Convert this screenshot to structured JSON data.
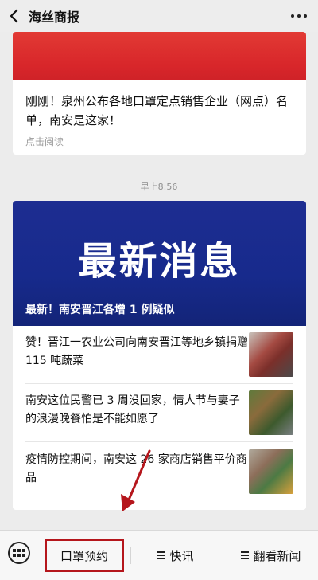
{
  "header": {
    "title": "海丝商报"
  },
  "card1": {
    "headline": "刚刚！泉州公布各地口罩定点销售企业（网点）名单，南安是这家！",
    "read_more": "点击阅读"
  },
  "timestamp": "早上8:56",
  "card2": {
    "hero_text": "最新消息",
    "hero_caption": "最新！南安晋江各增 1 例疑似",
    "items": [
      {
        "text": "赞！晋江一农业公司向南安晋江等地乡镇捐赠 115 吨蔬菜"
      },
      {
        "text": "南安这位民警已 3 周没回家，情人节与妻子的浪漫晚餐怕是不能如愿了"
      },
      {
        "text": "疫情防控期间，南安这 26 家商店销售平价商品"
      }
    ]
  },
  "bottom_menu": {
    "items": [
      {
        "label": "口罩预约"
      },
      {
        "label": "快讯"
      },
      {
        "label": "翻看新闻"
      }
    ]
  },
  "colors": {
    "red_banner": "#d8262a",
    "hero_blue": "#172a8c",
    "highlight": "#b5161c"
  }
}
